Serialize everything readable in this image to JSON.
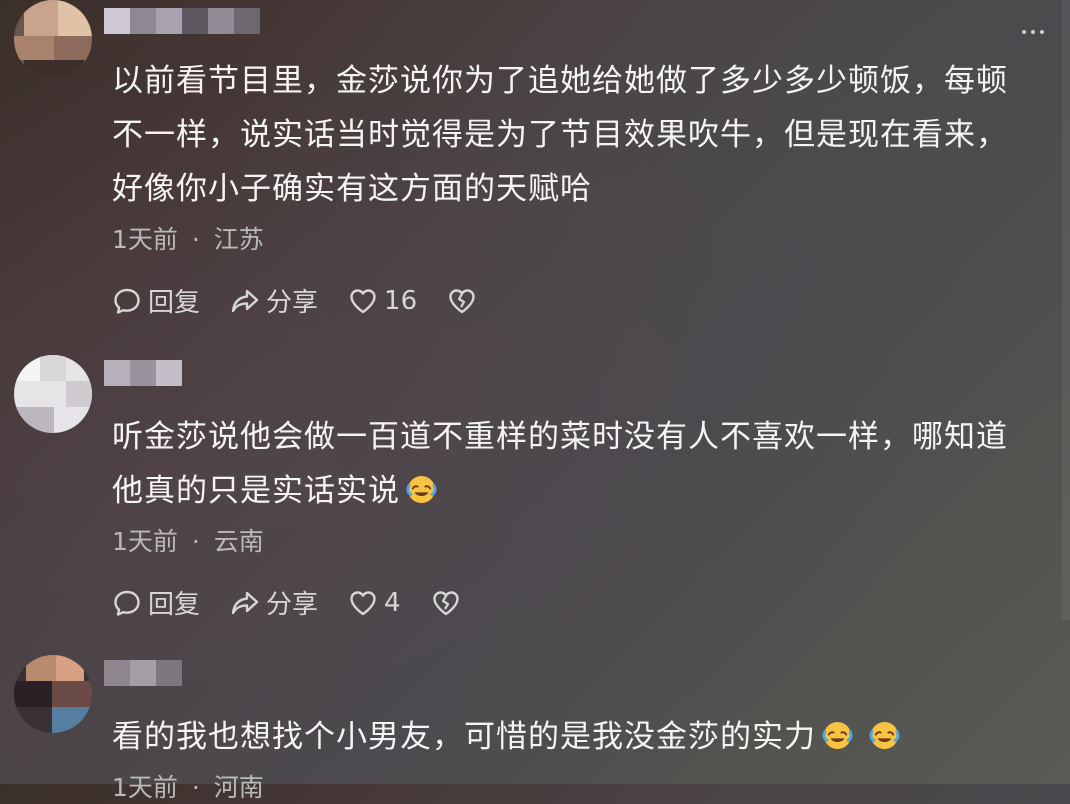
{
  "comments": [
    {
      "text": "以前看节目里，金莎说你为了追她给她做了多少多少顿饭，每顿不一样，说实话当时觉得是为了节目效果吹牛，但是现在看来，好像你小子确实有这方面的天赋哈",
      "time": "1天前",
      "separator": "·",
      "location": "江苏",
      "reply_label": "回复",
      "share_label": "分享",
      "likes": "16"
    },
    {
      "text": "听金莎说他会做一百道不重样的菜时没有人不喜欢一样，哪知道他真的只是实话实说",
      "emoji_count": 1,
      "time": "1天前",
      "separator": "·",
      "location": "云南",
      "reply_label": "回复",
      "share_label": "分享",
      "likes": "4"
    },
    {
      "text": "看的我也想找个小男友，可惜的是我没金莎的实力",
      "emoji_count": 2,
      "time": "1天前",
      "separator": "·",
      "location": "河南"
    }
  ],
  "icons": {
    "reply": "comment-bubble-icon",
    "share": "share-arrow-icon",
    "like": "heart-icon",
    "dislike": "broken-heart-icon",
    "more": "more-dots-icon",
    "emoji": "laughing-crying-emoji"
  }
}
